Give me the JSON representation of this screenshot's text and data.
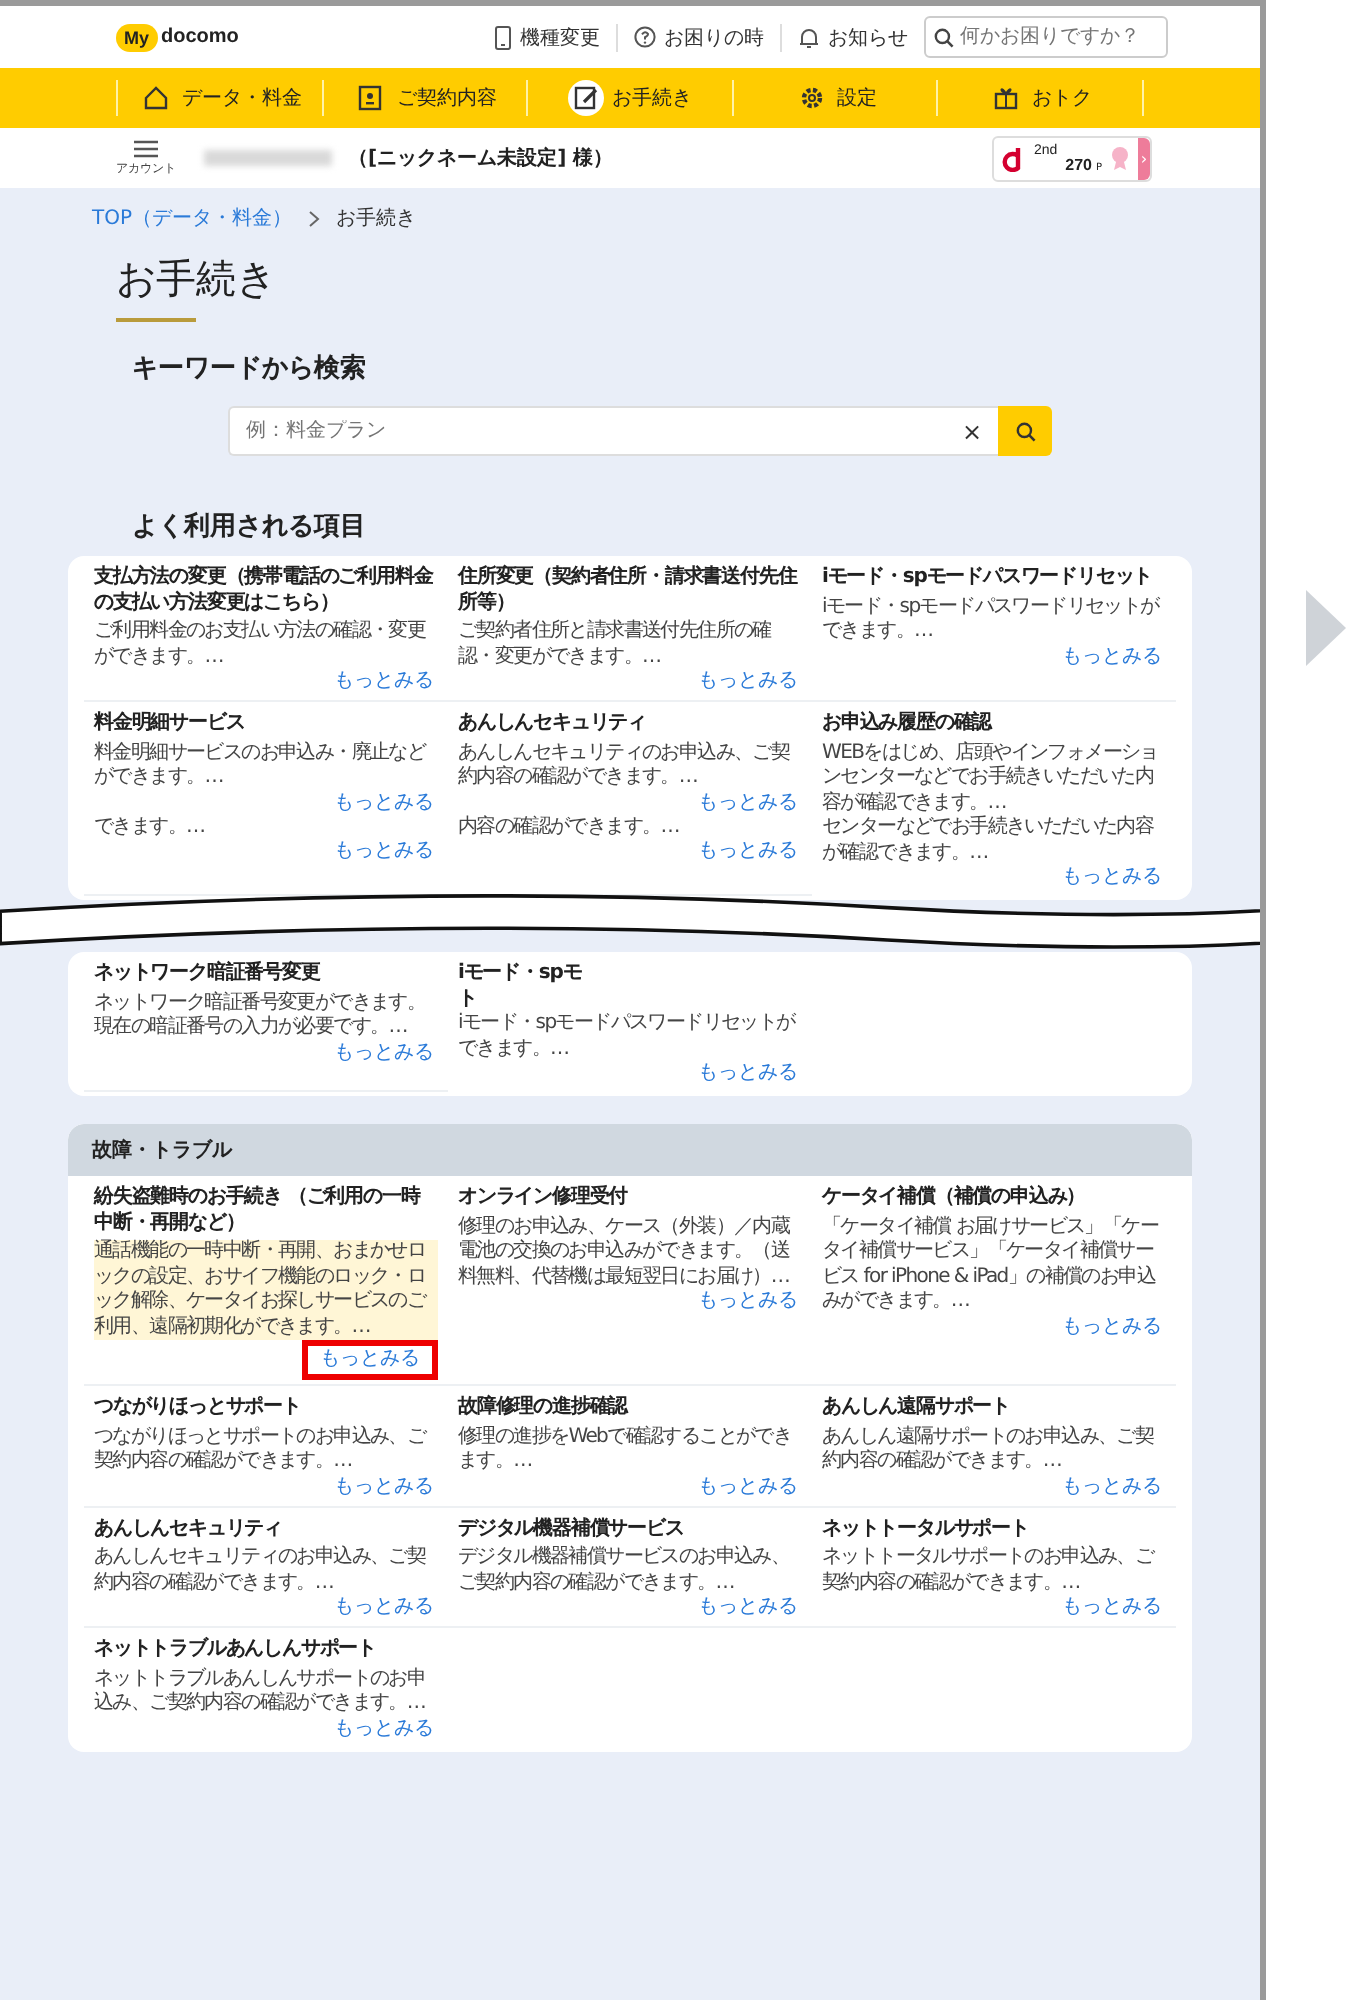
{
  "header": {
    "logo_badge": "My",
    "logo_text": "docomo",
    "links": [
      {
        "label": "機種変更",
        "kind": "phone"
      },
      {
        "label": "お困りの時",
        "kind": "help"
      },
      {
        "label": "お知らせ",
        "kind": "bell"
      }
    ],
    "search": {
      "placeholder": "何かお困りですか？"
    }
  },
  "nav": [
    {
      "label": "データ・料金",
      "kind": "home",
      "selected": false
    },
    {
      "label": "ご契約内容",
      "kind": "contract",
      "selected": false
    },
    {
      "label": "お手続き",
      "kind": "procedure",
      "selected": true
    },
    {
      "label": "設定",
      "kind": "settings",
      "selected": false
    },
    {
      "label": "おトク",
      "kind": "gift",
      "selected": false
    }
  ],
  "account": {
    "menu_label": "アカウント",
    "nickname": "（[ニックネーム未設定] 様）",
    "points": {
      "rank": "2nd",
      "value": "270",
      "unit": "P",
      "arrow": "›"
    }
  },
  "breadcrumb": [
    {
      "label": "TOP（データ・料金）",
      "link": true
    },
    {
      "label": "お手続き",
      "link": false
    }
  ],
  "page_title": "お手続き",
  "keyword_search": {
    "heading": "キーワードから検索",
    "placeholder": "例：料金プラン",
    "clear": "×"
  },
  "frequent": {
    "heading": "よく利用される項目",
    "cards": [
      {
        "items": [
          {
            "title": "支払方法の変更（携帯電話のご利用料金の支払い方法変更はこちら）",
            "blocks": [
              {
                "text": "ご利用料金のお支払い方法の確認・変更ができます。…",
                "link": "もっとみる",
                "highlight": false
              }
            ]
          },
          {
            "title": "住所変更（契約者住所・請求書送付先住所等）",
            "blocks": [
              {
                "text": "ご契約者住所と請求書送付先住所の確認・変更ができます。…",
                "link": "もっとみる",
                "highlight": false
              }
            ]
          },
          {
            "title": "iモード・spモードパスワードリセット",
            "blocks": [
              {
                "text": "iモード・spモードパスワードリセットができます。…",
                "link": "もっとみる",
                "highlight": false
              }
            ]
          },
          {
            "title": "料金明細サービス",
            "blocks": [
              {
                "text": "料金明細サービスのお申込み・廃止などができます。…",
                "link": "もっとみる",
                "highlight": false
              },
              {
                "text": "できます。…",
                "link": "もっとみる",
                "highlight": false
              }
            ]
          },
          {
            "title": "あんしんセキュリティ",
            "blocks": [
              {
                "text": "あんしんセキュリティのお申込み、ご契約内容の確認ができます。…",
                "link": "もっとみる",
                "highlight": false
              },
              {
                "text": "内容の確認ができます。…",
                "link": "もっとみる",
                "highlight": false
              }
            ]
          },
          {
            "title": "お申込み履歴の確認",
            "blocks": [
              {
                "text": "WEBをはじめ、店頭やインフォメーションセンターなどでお手続きいただいた内容が確認できます。…",
                "highlight": false
              },
              {
                "text": "センターなどでお手続きいただいた内容が確認できます。…",
                "link": "もっとみる",
                "highlight": false
              }
            ]
          }
        ]
      },
      {
        "items": [
          {
            "title": "ネットワーク暗証番号変更",
            "blocks": [
              {
                "text": "ネットワーク暗証番号変更ができます。現在の暗証番号の入力が必要です。…",
                "link": "もっとみる",
                "highlight": false
              }
            ]
          },
          {
            "title_lines": [
              "iモード・spモ",
              "ト"
            ],
            "blocks": [
              {
                "text": "iモード・spモードパスワードリセットができます。…",
                "link": "もっとみる",
                "highlight": false
              }
            ]
          }
        ]
      }
    ]
  },
  "trouble": {
    "heading": "故障・トラブル",
    "items": [
      {
        "title": "紛失盗難時のお手続き （ご利用の一時中断・再開など）",
        "blocks": [
          {
            "text": "通話機能の一時中断・再開、おまかせロックの設定、おサイフ機能のロック・ロック解除、ケータイお探しサービスのご利用、遠隔初期化ができます。…",
            "link": "もっとみる",
            "highlight": true
          }
        ]
      },
      {
        "title": "オンライン修理受付",
        "blocks": [
          {
            "text": "修理のお申込み、ケース（外装）／内蔵電池の交換のお申込みができます。（送料無料、代替機は最短翌日にお届け）…",
            "link": "もっとみる",
            "highlight": false
          }
        ]
      },
      {
        "title": "ケータイ補償（補償の申込み）",
        "blocks": [
          {
            "text": "「ケータイ補償 お届けサービス」「ケータイ補償サービス」「ケータイ補償サービス for iPhone & iPad」の補償のお申込みができます。…",
            "link": "もっとみる",
            "highlight": false
          }
        ]
      },
      {
        "title": "つながりほっとサポート",
        "blocks": [
          {
            "text": "つながりほっとサポートのお申込み、ご契約内容の確認ができます。…",
            "link": "もっとみる",
            "highlight": false
          }
        ]
      },
      {
        "title": "故障修理の進捗確認",
        "blocks": [
          {
            "text": "修理の進捗をWebで確認することができます。…",
            "link": "もっとみる",
            "highlight": false
          }
        ]
      },
      {
        "title": "あんしん遠隔サポート",
        "blocks": [
          {
            "text": "あんしん遠隔サポートのお申込み、ご契約内容の確認ができます。…",
            "link": "もっとみる",
            "highlight": false
          }
        ]
      },
      {
        "title": "あんしんセキュリティ",
        "blocks": [
          {
            "text": "あんしんセキュリティのお申込み、ご契約内容の確認ができます。…",
            "link": "もっとみる",
            "highlight": false
          }
        ]
      },
      {
        "title": "デジタル機器補償サービス",
        "blocks": [
          {
            "text": "デジタル機器補償サービスのお申込み、ご契約内容の確認ができます。…",
            "link": "もっとみる",
            "highlight": false
          }
        ]
      },
      {
        "title": "ネットトータルサポート",
        "blocks": [
          {
            "text": "ネットトータルサポートのお申込み、ご契約内容の確認ができます。…",
            "link": "もっとみる",
            "highlight": false
          }
        ]
      },
      {
        "title": "ネットトラブルあんしんサポート",
        "blocks": [
          {
            "text": "ネットトラブルあんしんサポートのお申込み、ご契約内容の確認ができます。…",
            "link": "もっとみる",
            "highlight": false
          }
        ]
      }
    ]
  }
}
